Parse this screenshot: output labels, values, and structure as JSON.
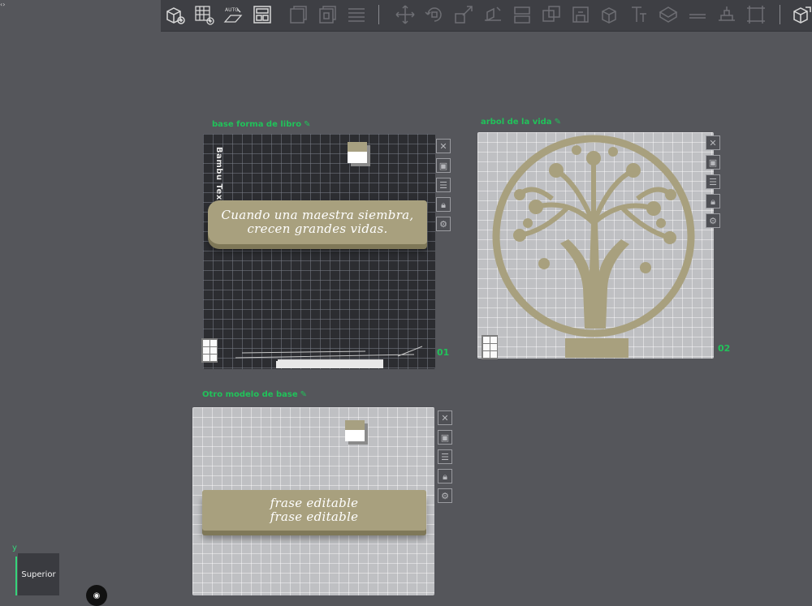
{
  "corner": {
    "label": "‹›"
  },
  "toolbar": {
    "buttons": [
      {
        "name": "add-cube-icon"
      },
      {
        "name": "add-plate-icon"
      },
      {
        "name": "auto-orient-icon"
      },
      {
        "name": "arrange-icon"
      },
      {
        "name": "split-objects-icon"
      },
      {
        "name": "split-parts-icon"
      },
      {
        "name": "layers-icon"
      },
      {
        "name": "move-icon"
      },
      {
        "name": "rotate-icon"
      },
      {
        "name": "scale-icon"
      },
      {
        "name": "lay-on-face-icon"
      },
      {
        "name": "cut-icon"
      },
      {
        "name": "mesh-boolean-icon"
      },
      {
        "name": "support-paint-icon"
      },
      {
        "name": "seam-paint-icon"
      },
      {
        "name": "text-shape-icon"
      },
      {
        "name": "measure-icon"
      },
      {
        "name": "assembly-icon"
      },
      {
        "name": "brim-ears-icon"
      },
      {
        "name": "variable-layer-icon"
      },
      {
        "name": "view-settings-icon"
      }
    ]
  },
  "plates": [
    {
      "title": "base forma de libro",
      "number": "01"
    },
    {
      "title": "arbol de la vida",
      "number": "02"
    },
    {
      "title": "Otro modelo de base",
      "number": ""
    }
  ],
  "models": {
    "book_line1": "Cuando una maestra siembra,",
    "book_line2": "crecen grandes vidas.",
    "base_line1": "frase editable",
    "base_line2": "frase editable",
    "texture_label": "Bambu Textur"
  },
  "plate_controls": [
    "close-icon",
    "image-icon",
    "plate-settings-icon",
    "lock-icon",
    "gear-icon"
  ],
  "view": {
    "label": "Superior",
    "axis": "y"
  },
  "colors": {
    "accent": "#21c25a",
    "model": "#a8a07e",
    "background": "#55565b"
  }
}
